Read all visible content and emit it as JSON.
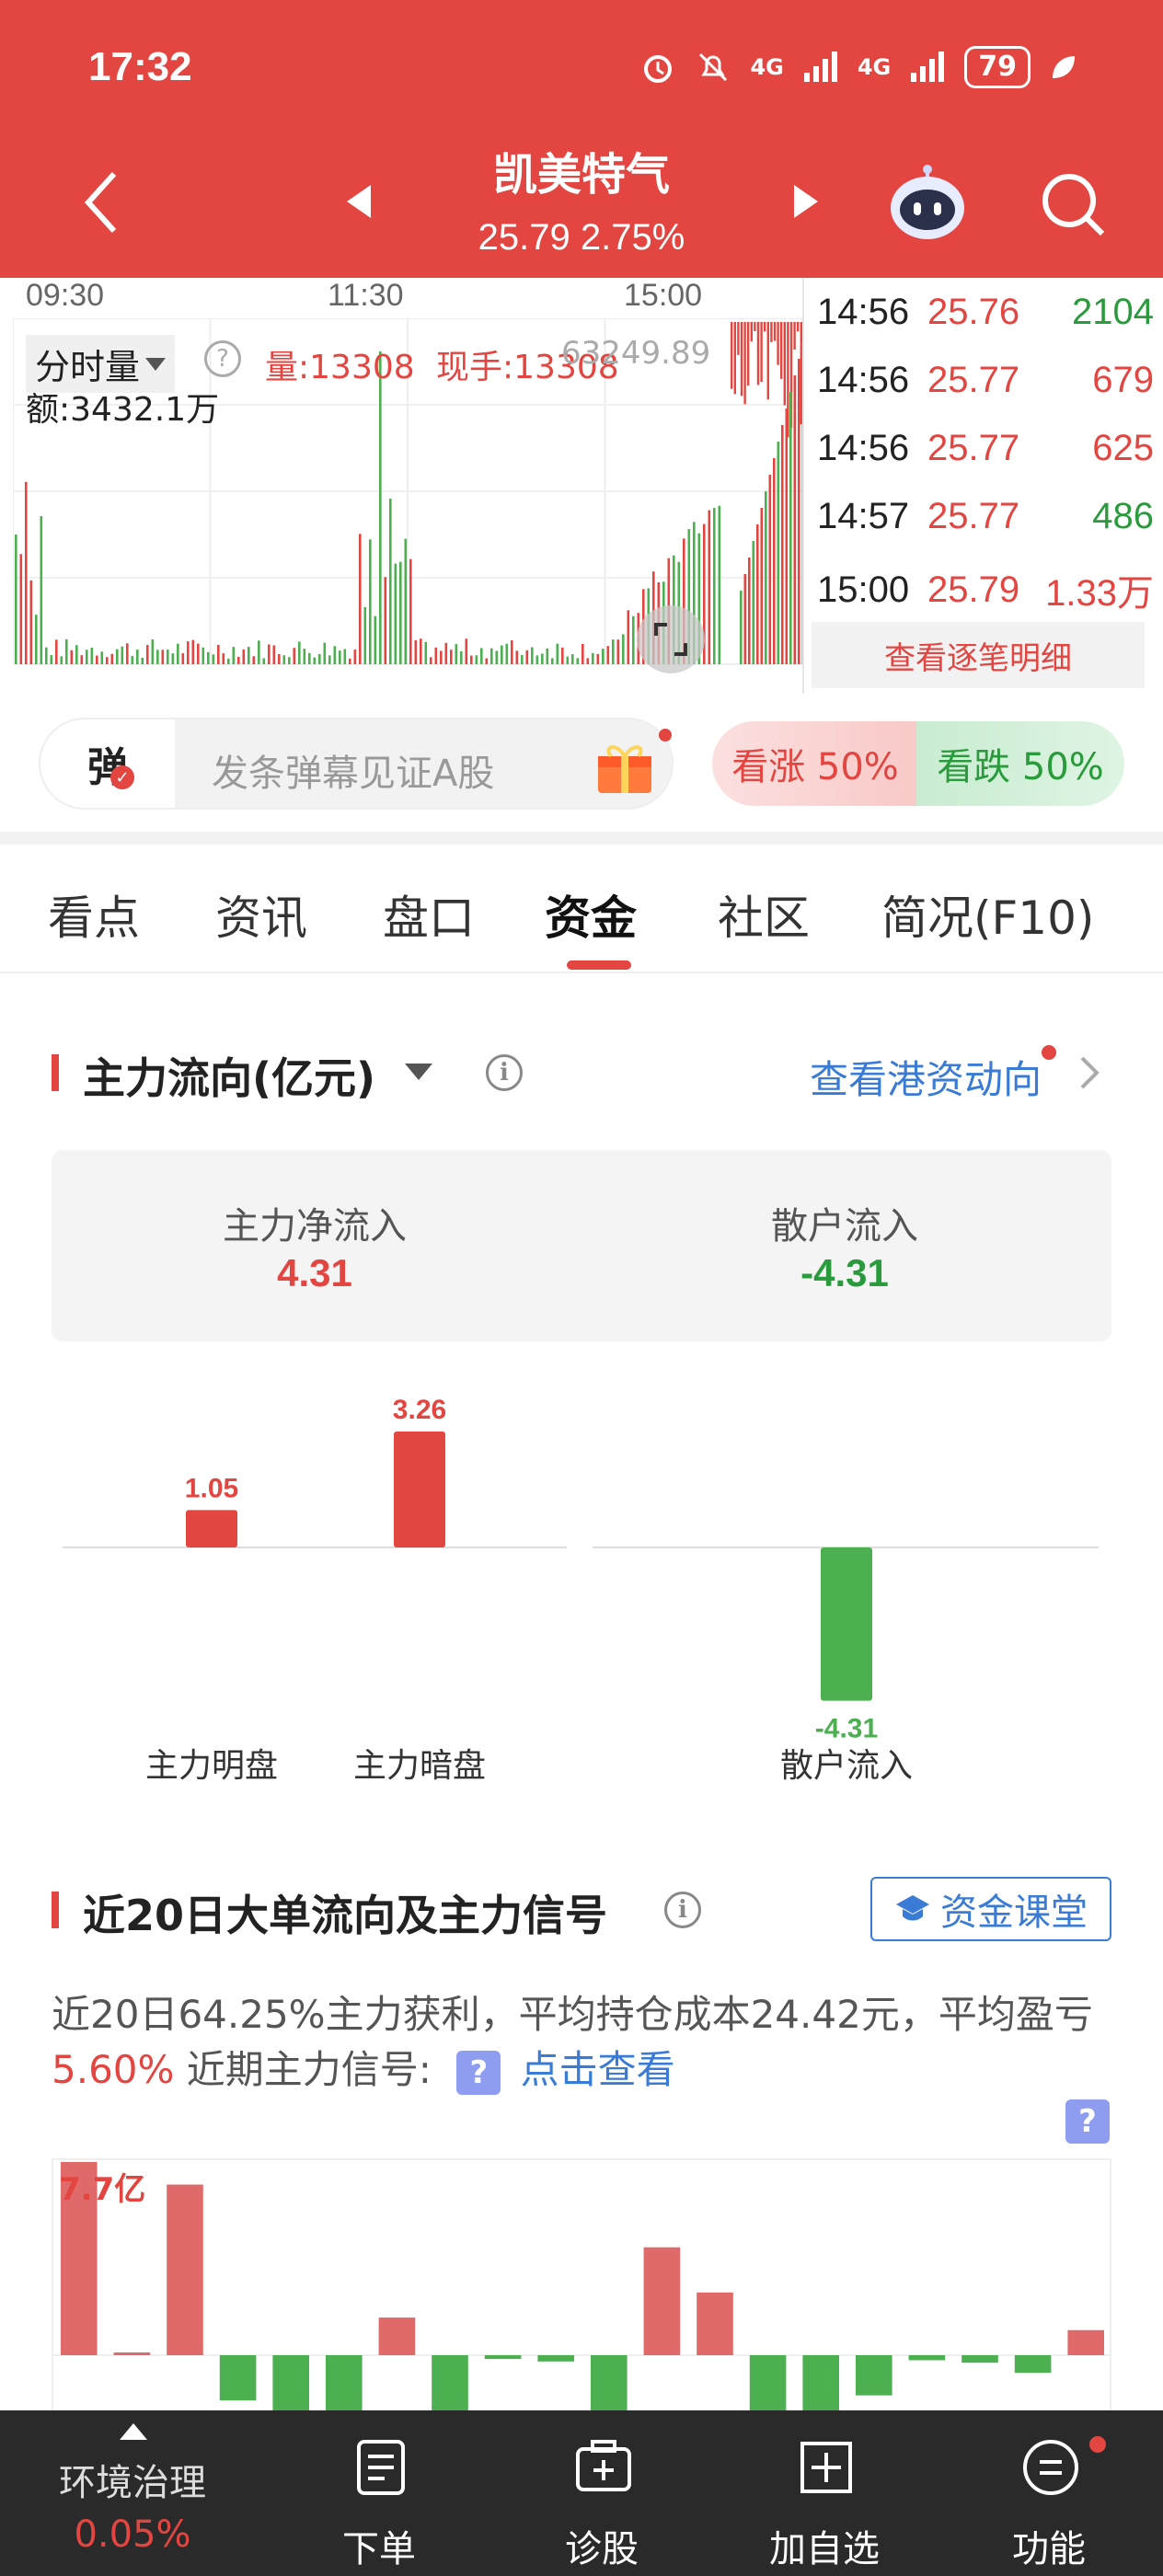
{
  "status_bar": {
    "time": "17:32",
    "battery": "79",
    "signal1": "4G",
    "signal2": "4G"
  },
  "header": {
    "title": "凯美特气",
    "price": "25.79",
    "change": "2.75%"
  },
  "chart": {
    "time_labels": [
      "09:30",
      "11:30",
      "15:00"
    ],
    "mode_label": "分时量",
    "volume": "量:13308",
    "current_hand": "现手:13308",
    "partial_number": "63249.89",
    "amount": "额:3432.1万"
  },
  "ticks": [
    {
      "time": "14:56",
      "price": "25.76",
      "vol": "2104",
      "vol_color": "#2a9b3c"
    },
    {
      "time": "14:56",
      "price": "25.77",
      "vol": "679",
      "vol_color": "#e34540"
    },
    {
      "time": "14:56",
      "price": "25.77",
      "vol": "625",
      "vol_color": "#e34540"
    },
    {
      "time": "14:57",
      "price": "25.77",
      "vol": "486",
      "vol_color": "#2a9b3c"
    },
    {
      "time": "15:00",
      "price": "25.79",
      "vol": "1.33万",
      "vol_color": "#e34540"
    }
  ],
  "tick_detail_label": "查看逐笔明细",
  "danmu": {
    "badge": "弹",
    "placeholder": "发条弹幕见证A股",
    "bull": "看涨 50%",
    "bear": "看跌 50%"
  },
  "tabs": [
    {
      "label": "看点",
      "active": false
    },
    {
      "label": "资讯",
      "active": false
    },
    {
      "label": "盘口",
      "active": false
    },
    {
      "label": "资金",
      "active": true
    },
    {
      "label": "社区",
      "active": false
    },
    {
      "label": "简况(F10)",
      "active": false
    }
  ],
  "main_flow": {
    "title": "主力流向(亿元)",
    "hk_link": "查看港资动向",
    "net_inflow_label": "主力净流入",
    "net_inflow_value": "4.31",
    "retail_label": "散户流入",
    "retail_value": "-4.31"
  },
  "chart_data": {
    "type": "bar",
    "categories": [
      "主力明盘",
      "主力暗盘",
      "散户流入"
    ],
    "values": [
      1.05,
      3.26,
      -4.31
    ],
    "value_labels": [
      "1.05",
      "3.26",
      "-4.31"
    ],
    "colors": [
      "#e34540",
      "#e34540",
      "#4caf50"
    ]
  },
  "big_order": {
    "title": "近20日大单流向及主力信号",
    "classroom": "资金课堂",
    "desc_part1": "近20日64.25%主力获利，平均持仓成本24.42元，平均盈亏",
    "desc_pct": "5.60%",
    "desc_part2": " 近期主力信号:",
    "desc_link": "点击查看",
    "max_label": "7.7亿",
    "values": [
      7.7,
      0.1,
      6.8,
      -1.8,
      -2.4,
      -2.4,
      1.5,
      -2.4,
      -0.15,
      -0.25,
      -2.4,
      4.3,
      2.5,
      -2.4,
      -2.4,
      -1.6,
      -0.2,
      -0.3,
      -0.7,
      1.0
    ]
  },
  "bottom_bar": {
    "sector": "环境治理",
    "sector_change": "0.05%",
    "order": "下单",
    "diagnose": "诊股",
    "add_watch": "加自选",
    "functions": "功能"
  }
}
